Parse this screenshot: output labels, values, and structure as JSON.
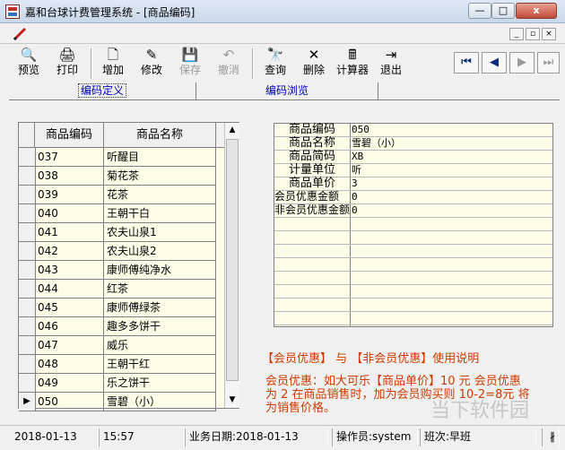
{
  "window": {
    "title": "嘉和台球计费管理系统 - [商品编码]",
    "close_glyph": "x",
    "min_glyph": "—",
    "max_glyph": "□"
  },
  "toolbar": {
    "buttons": [
      {
        "label": "预览",
        "icon": "preview-icon",
        "glyph": "🔍",
        "enabled": true
      },
      {
        "label": "打印",
        "icon": "print-icon",
        "glyph": "🖨",
        "enabled": true
      },
      {
        "label": "增加",
        "icon": "new-document-icon",
        "glyph": "🗋",
        "enabled": true
      },
      {
        "label": "修改",
        "icon": "edit-icon",
        "glyph": "✎",
        "enabled": true
      },
      {
        "label": "保存",
        "icon": "save-icon",
        "glyph": "💾",
        "enabled": false
      },
      {
        "label": "撤消",
        "icon": "undo-icon",
        "glyph": "↶",
        "enabled": false
      },
      {
        "label": "查询",
        "icon": "binoculars-icon",
        "glyph": "🔭",
        "enabled": true
      },
      {
        "label": "删除",
        "icon": "delete-icon",
        "glyph": "✕",
        "enabled": true
      },
      {
        "label": "计算器",
        "icon": "calculator-icon",
        "glyph": "🖩",
        "enabled": true
      },
      {
        "label": "退出",
        "icon": "exit-door-icon",
        "glyph": "⇥",
        "enabled": true
      }
    ],
    "nav": [
      {
        "icon": "first-record-icon",
        "glyph": "⏮",
        "enabled": true
      },
      {
        "icon": "prev-record-icon",
        "glyph": "◀",
        "enabled": true
      },
      {
        "icon": "next-record-icon",
        "glyph": "▶",
        "enabled": false
      },
      {
        "icon": "last-record-icon",
        "glyph": "⏭",
        "enabled": false
      }
    ]
  },
  "tabs": {
    "define": "编码定义",
    "browse": "编码浏览"
  },
  "grid": {
    "headers": {
      "code": "商品编码",
      "name": "商品名称"
    },
    "rows": [
      {
        "code": "037",
        "name": "听醒目"
      },
      {
        "code": "038",
        "name": "菊花茶"
      },
      {
        "code": "039",
        "name": "花茶"
      },
      {
        "code": "040",
        "name": "王朝干白"
      },
      {
        "code": "041",
        "name": "农夫山泉1"
      },
      {
        "code": "042",
        "name": "农夫山泉2"
      },
      {
        "code": "043",
        "name": "康师傅纯净水"
      },
      {
        "code": "044",
        "name": "红茶"
      },
      {
        "code": "045",
        "name": "康师傅绿茶"
      },
      {
        "code": "046",
        "name": "趣多多饼干"
      },
      {
        "code": "047",
        "name": "威乐"
      },
      {
        "code": "048",
        "name": "王朝干红"
      },
      {
        "code": "049",
        "name": "乐之饼干"
      },
      {
        "code": "050",
        "name": "雪碧（小）"
      }
    ],
    "current_index": 13,
    "current_marker": "▶"
  },
  "form": {
    "fields": [
      {
        "label": "商品编码",
        "value": "050"
      },
      {
        "label": "商品名称",
        "value": "雪碧（小）"
      },
      {
        "label": "商品简码",
        "value": "XB"
      },
      {
        "label": "计量单位",
        "value": "听"
      },
      {
        "label": "商品单价",
        "value": "3"
      },
      {
        "label": "会员优惠金额",
        "value": "0"
      },
      {
        "label": "非会员优惠金额",
        "value": "0"
      }
    ]
  },
  "usage": {
    "title": "【会员优惠】 与 【非会员优惠】使用说明",
    "body": "会员优惠：如大可乐【商品单价】10 元 会员优惠 为 2  在商品销售时，加为会员购买则 10-2=8元 将为销售价格。"
  },
  "status": {
    "date": "2018-01-13",
    "time": "15:57",
    "business_date": "业务日期:2018-01-13",
    "operator": "操作员:system",
    "shift": "班次:早班",
    "grip": "∦"
  },
  "watermark": "当下软件园"
}
